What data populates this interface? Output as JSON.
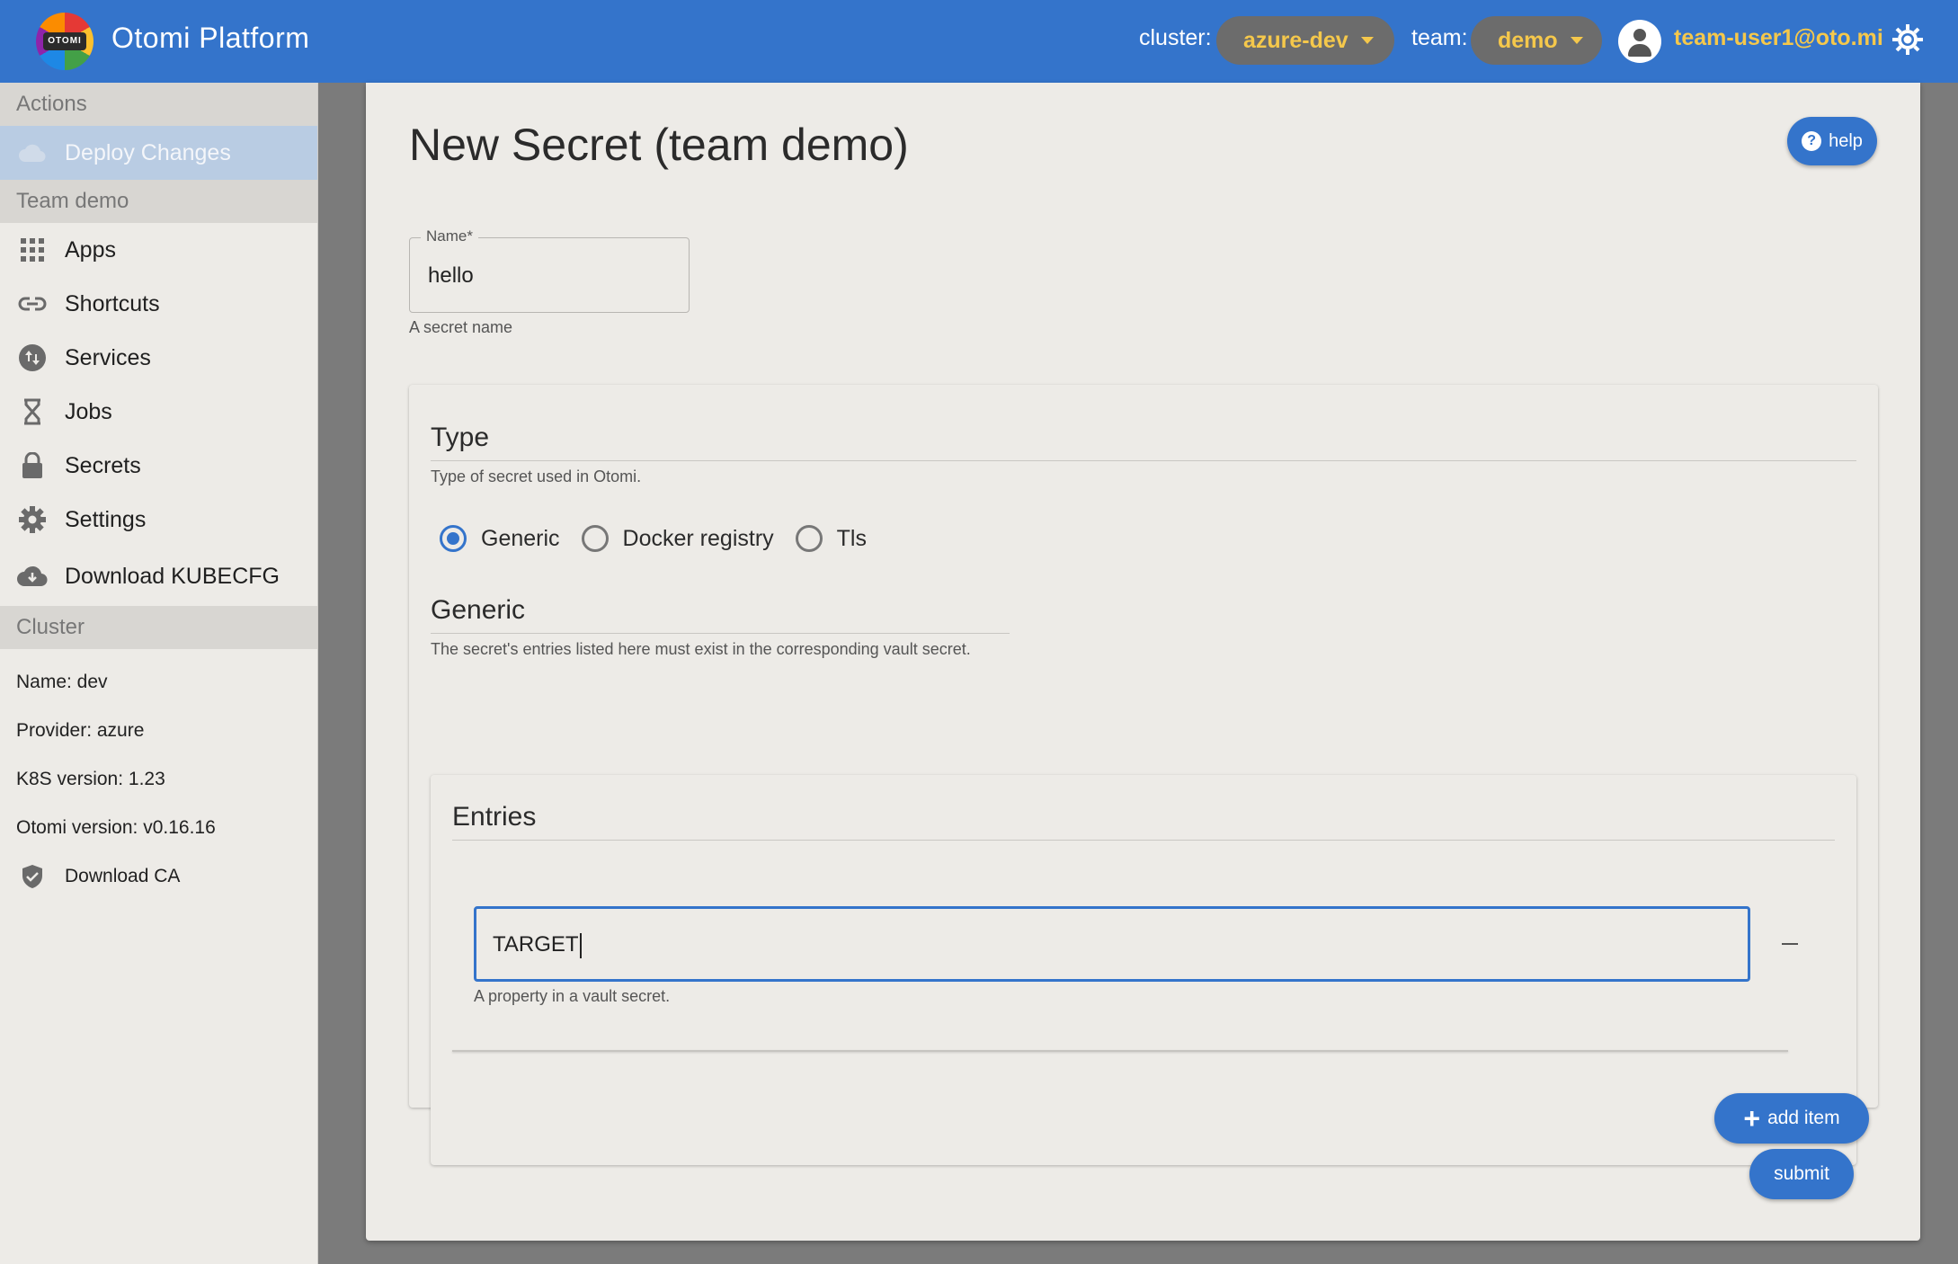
{
  "header": {
    "logo_text": "OTOMI",
    "app_title": "Otomi Platform",
    "cluster_label": "cluster:",
    "cluster_value": "azure-dev",
    "team_label": "team:",
    "team_value": "demo",
    "user_email": "team-user1@oto.mi"
  },
  "sidebar": {
    "actions_heading": "Actions",
    "deploy_label": "Deploy Changes",
    "team_heading": "Team demo",
    "items": [
      {
        "label": "Apps",
        "icon": "apps-grid-icon"
      },
      {
        "label": "Shortcuts",
        "icon": "link-icon"
      },
      {
        "label": "Services",
        "icon": "swap-icon"
      },
      {
        "label": "Jobs",
        "icon": "hourglass-icon"
      },
      {
        "label": "Secrets",
        "icon": "lock-icon"
      },
      {
        "label": "Settings",
        "icon": "gear-icon"
      },
      {
        "label": "Download KUBECFG",
        "icon": "cloud-download-icon"
      }
    ],
    "cluster_heading": "Cluster",
    "cluster_info": [
      "Name: dev",
      "Provider: azure",
      "K8S version: 1.23",
      "Otomi version: v0.16.16"
    ],
    "download_ca": "Download CA"
  },
  "form": {
    "title": "New Secret (team demo)",
    "help_label": "help",
    "name_legend": "Name*",
    "name_value": "hello",
    "name_help": "A secret name",
    "type_title": "Type",
    "type_desc": "Type of secret used in Otomi.",
    "type_options": [
      "Generic",
      "Docker registry",
      "Tls"
    ],
    "type_selected": "Generic",
    "generic_title": "Generic",
    "generic_desc": "The secret's entries listed here must exist in the corresponding vault secret.",
    "entries_title": "Entries",
    "entry_value": "TARGET",
    "entry_help": "A property in a vault secret.",
    "add_item_label": "add item",
    "submit_label": "submit"
  },
  "colors": {
    "primary": "#3474cb",
    "accent": "#f5c84b",
    "surface": "#edebe7",
    "backdrop": "#7b7b7b"
  }
}
